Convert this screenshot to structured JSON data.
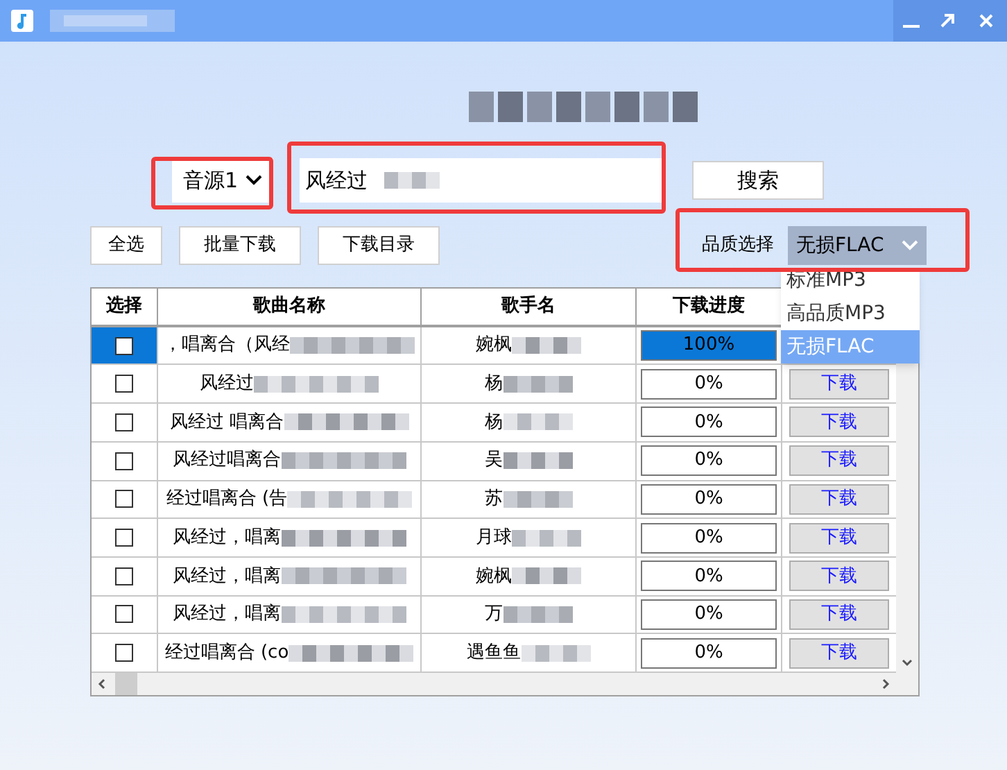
{
  "source_select": {
    "value": "音源1"
  },
  "search": {
    "value": "风经过"
  },
  "search_button": "搜索",
  "buttons": [
    "全选",
    "批量下载",
    "下载目录"
  ],
  "quality": {
    "label": "品质选择",
    "value": "无损FLAC",
    "expanded": true,
    "options": [
      {
        "label": "标准MP3",
        "selected": false
      },
      {
        "label": "高品质MP3",
        "selected": false
      },
      {
        "label": "无损FLAC",
        "selected": true
      }
    ]
  },
  "table": {
    "columns": [
      "选择",
      "歌曲名称",
      "歌手名",
      "下载进度"
    ],
    "rows": [
      {
        "selected": true,
        "checked": false,
        "song": "，唱离合（风经",
        "singer": "婉枫",
        "progress": {
          "level": 1,
          "text": "100%"
        }
      },
      {
        "selected": false,
        "checked": false,
        "song": "风经过",
        "singer": "杨",
        "progress": {
          "level": 0,
          "text": "0%"
        },
        "download": "下载"
      },
      {
        "selected": false,
        "checked": false,
        "song": "风经过 唱离合",
        "singer": "杨",
        "progress": {
          "level": 0,
          "text": "0%"
        },
        "download": "下载"
      },
      {
        "selected": false,
        "checked": false,
        "song": "风经过唱离合",
        "singer": "吴",
        "progress": {
          "level": 0,
          "text": "0%"
        },
        "download": "下载"
      },
      {
        "selected": false,
        "checked": false,
        "song": "经过唱离合 (告",
        "singer": "苏",
        "progress": {
          "level": 0,
          "text": "0%"
        },
        "download": "下载"
      },
      {
        "selected": false,
        "checked": false,
        "song": "风经过，唱离",
        "singer": "月球",
        "progress": {
          "level": 0,
          "text": "0%"
        },
        "download": "下载"
      },
      {
        "selected": false,
        "checked": false,
        "song": "风经过，唱离",
        "singer": "婉枫",
        "progress": {
          "level": 0,
          "text": "0%"
        },
        "download": "下载"
      },
      {
        "selected": false,
        "checked": false,
        "song": "风经过，唱离",
        "singer": "万",
        "progress": {
          "level": 0,
          "text": "0%"
        },
        "download": "下载"
      },
      {
        "selected": false,
        "checked": false,
        "song": "经过唱离合 (co",
        "singer": "遇鱼鱼",
        "progress": {
          "level": 0,
          "text": "0%"
        },
        "download": "下载"
      }
    ]
  }
}
